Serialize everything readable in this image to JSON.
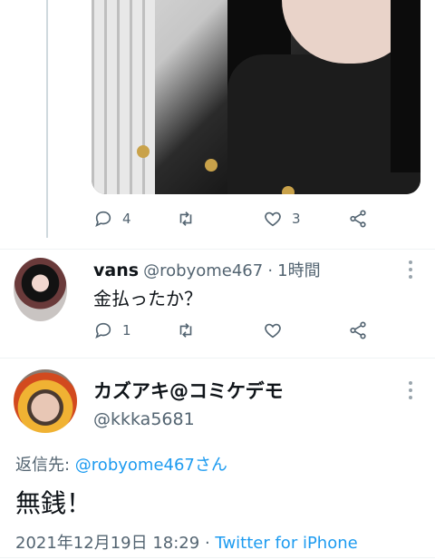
{
  "top_tweet": {
    "actions": {
      "reply_count": "4",
      "retweet_count": "",
      "like_count": "3"
    }
  },
  "reply_tweet": {
    "display_name": "vans",
    "handle": "@robyome467",
    "separator": "·",
    "time": "1時間",
    "text": "金払ったか？",
    "actions": {
      "reply_count": "1",
      "retweet_count": "",
      "like_count": ""
    }
  },
  "main_tweet": {
    "display_name": "カズアキ@コミケデモ",
    "handle": "@kkka5681",
    "reply_to_label": "返信先: ",
    "reply_to_handle": "@robyome467さん",
    "text": "無銭！",
    "timestamp": "2021年12月19日 18:29",
    "separator": "·",
    "source": "Twitter for iPhone"
  },
  "colors": {
    "link": "#1d9bf0",
    "muted": "#536471",
    "text": "#0f1419"
  },
  "icons": [
    "reply-icon",
    "retweet-icon",
    "like-icon",
    "share-icon",
    "more-icon"
  ]
}
